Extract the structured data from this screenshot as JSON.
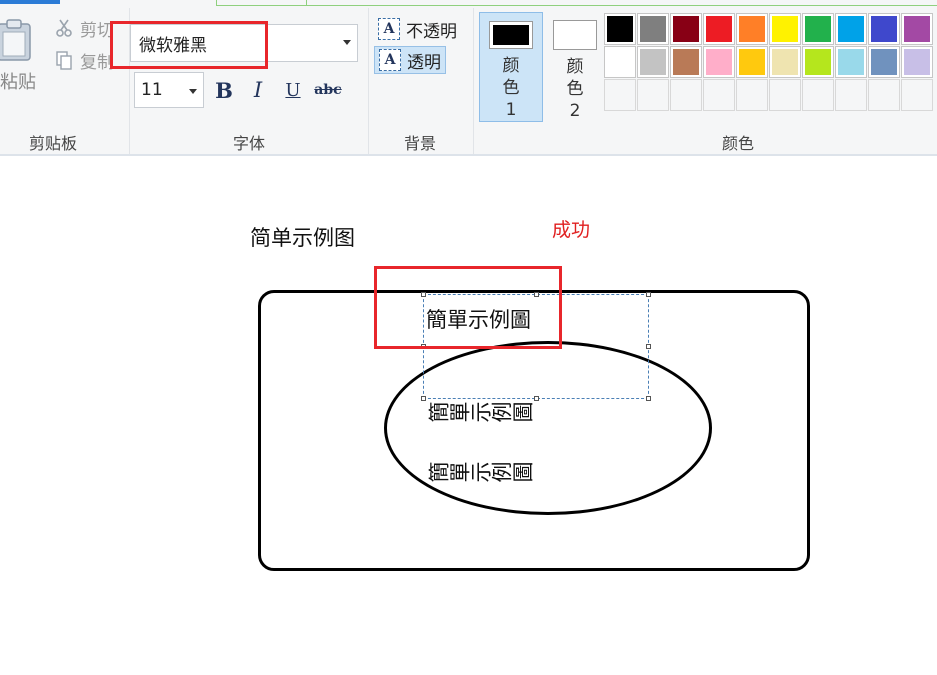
{
  "clipboard": {
    "paste_label": "粘贴",
    "cut_label": "剪切",
    "copy_label": "复制",
    "group_label": "剪贴板"
  },
  "font": {
    "family_value": "微软雅黑",
    "size_value": "11",
    "bold_label": "B",
    "italic_label": "I",
    "underline_label": "U",
    "strike_label": "abc",
    "group_label": "字体"
  },
  "background": {
    "opaque_label": "不透明",
    "transparent_label": "透明",
    "icon_letter": "A",
    "group_label": "背景"
  },
  "colors": {
    "color1_label": "颜色 1",
    "color2_label": "颜色 2",
    "color1_value": "#000000",
    "color2_value": "#ffffff",
    "group_label": "颜色",
    "palette": [
      "#000000",
      "#7f7f7f",
      "#880015",
      "#ed1c24",
      "#ff7f27",
      "#fff200",
      "#22b14c",
      "#00a2e8",
      "#3f48cc",
      "#a349a4",
      "#ffffff",
      "#c3c3c3",
      "#b97a57",
      "#ffaec9",
      "#ffc90e",
      "#efe4b0",
      "#b5e61d",
      "#99d9ea",
      "#7092be",
      "#c8bfe7",
      "",
      "",
      "",
      "",
      "",
      "",
      "",
      "",
      "",
      ""
    ]
  },
  "canvas": {
    "caption": "简单示例图",
    "success_note": "成功",
    "textbox_text": "簡單示例圖",
    "vertical_text_1": "簡單示例圖",
    "vertical_text_2": "簡單示例圖"
  },
  "highlight_color": "#e8262b"
}
